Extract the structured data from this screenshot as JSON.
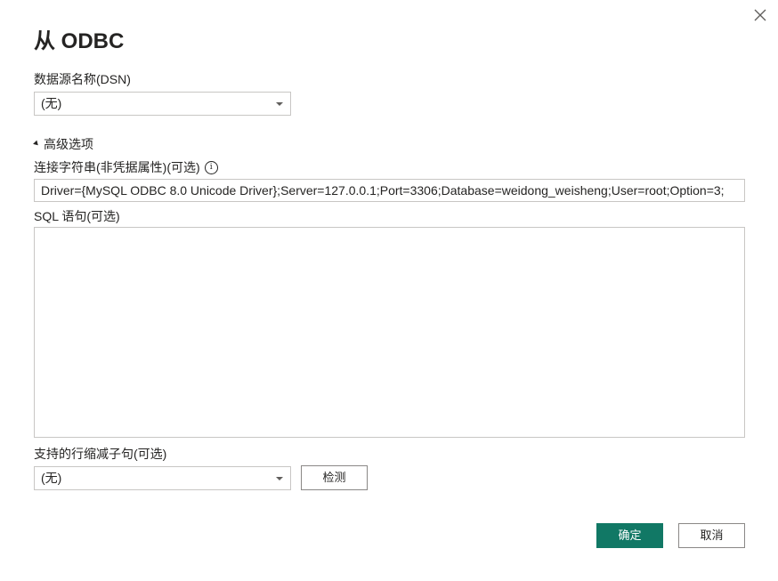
{
  "dialog": {
    "title": "从 ODBC",
    "close_icon": "close-icon"
  },
  "dsn": {
    "label": "数据源名称(DSN)",
    "selected": "(无)"
  },
  "advanced": {
    "toggle_label": "高级选项",
    "expanded": true,
    "connection_string": {
      "label": "连接字符串(非凭据属性)(可选)",
      "info_glyph": "i",
      "value": "Driver={MySQL ODBC 8.0 Unicode Driver};Server=127.0.0.1;Port=3306;Database=weidong_weisheng;User=root;Option=3;"
    },
    "sql": {
      "label": "SQL 语句(可选)",
      "value": ""
    },
    "row_reduction": {
      "label": "支持的行缩减子句(可选)",
      "selected": "(无)",
      "detect_button": "检测"
    }
  },
  "footer": {
    "ok_button": "确定",
    "cancel_button": "取消"
  },
  "colors": {
    "primary": "#117865",
    "border": "#c8c6c4",
    "text": "#252423"
  }
}
